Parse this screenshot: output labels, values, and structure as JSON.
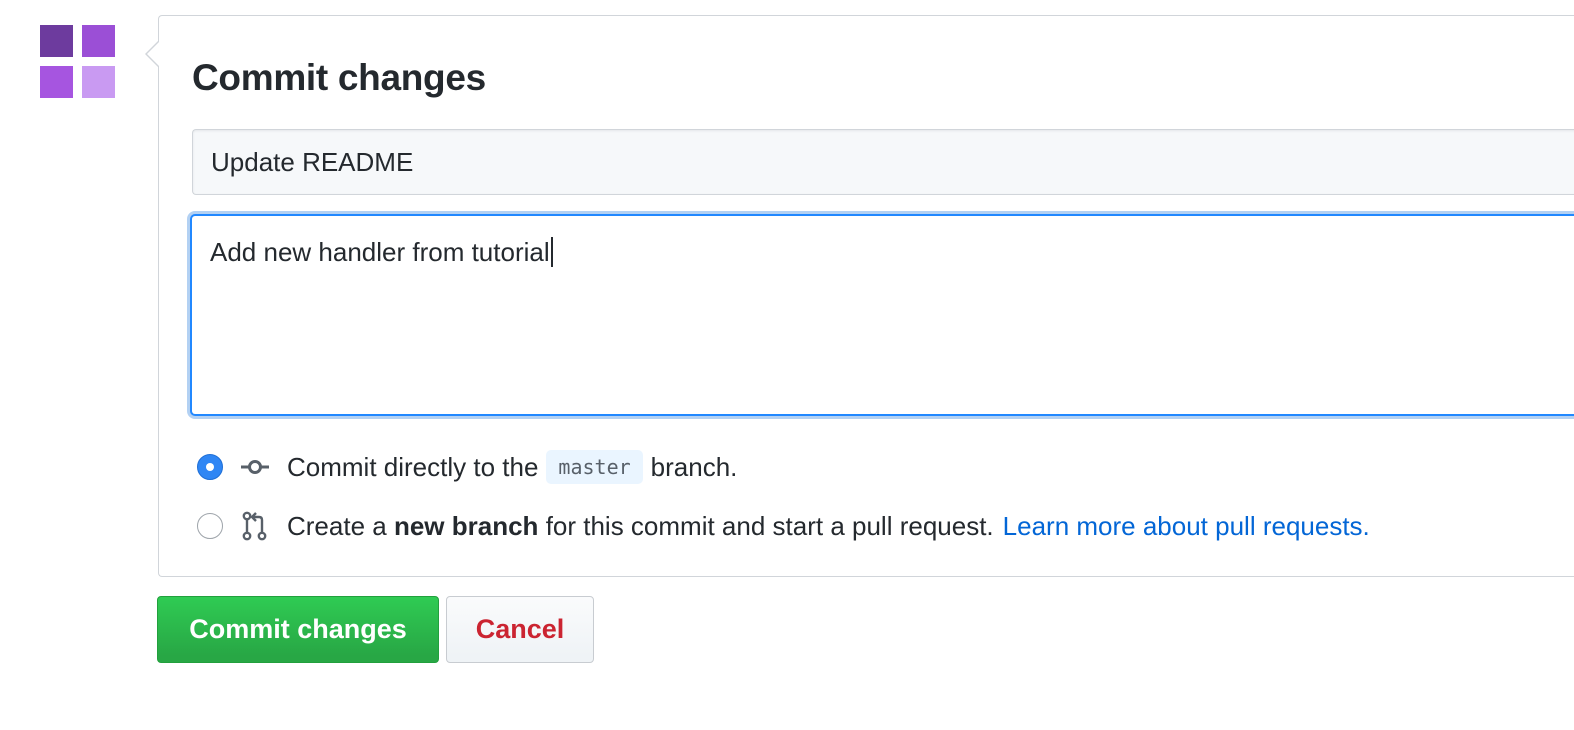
{
  "avatar": {
    "icon": "identicon-avatar-icon",
    "colors": [
      "#6d3b9e",
      "#9b4fd6",
      "#a655e0",
      "#c99af2"
    ]
  },
  "commit_form": {
    "title": "Commit changes",
    "summary_value": "Update README",
    "description_value": "Add new handler from tutorial",
    "options": [
      {
        "checked": true,
        "icon": "git-commit-icon",
        "text_before": "Commit directly to the",
        "branch_name": "master",
        "text_after": "branch."
      },
      {
        "checked": false,
        "icon": "git-pull-request-icon",
        "text_before": "Create a",
        "bold_text": "new branch",
        "text_after": "for this commit and start a pull request.",
        "link_text": "Learn more about pull requests."
      }
    ]
  },
  "actions": {
    "commit_label": "Commit changes",
    "cancel_label": "Cancel"
  },
  "colors": {
    "primary_button": "#28a745",
    "cancel_text": "#cb2431",
    "link": "#0366d6",
    "focus_border": "#2188ff",
    "radio_checked": "#2f86f4"
  }
}
